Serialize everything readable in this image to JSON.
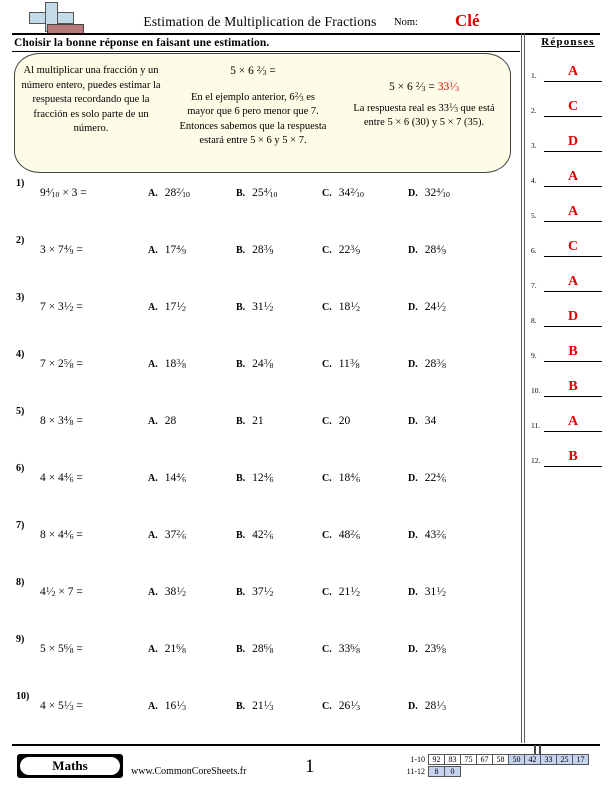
{
  "header": {
    "title": "Estimation de Multiplication de Fractions",
    "name_label": "Nom:",
    "name_value": "Clé",
    "logo_icon": "cross-book-logo"
  },
  "instruction": "Choisir la bonne réponse en faisant une estimation.",
  "example_box": {
    "col1": "Al multiplicar una fracción y un número entero, puedes estimar la respuesta recordando que la fracción es solo parte de un número.",
    "col2_equation": {
      "whole": "5 × 6",
      "num": "2",
      "den": "3",
      "tail": "="
    },
    "col2_text": "En el ejemplo anterior, 6 ⅔ es mayor que 6 pero menor que 7. Entonces sabemos que la respuesta estará entre 5 × 6 y 5 × 7.",
    "col2_text_a": "En el ejemplo anterior, 6",
    "col2_text_b": "es",
    "col2_text_c": "mayor que 6 pero menor que 7.",
    "col2_text_d": "Entonces sabemos que la respuesta",
    "col2_text_e": "estará entre 5 × 6 y 5 × 7.",
    "col3_equation": {
      "whole": "5 × 6",
      "num": "2",
      "den": "3",
      "eq": "=",
      "ans_whole": "33",
      "ans_num": "1",
      "ans_den": "3"
    },
    "col3_text_a": "La respuesta real es 33",
    "col3_text_b": "que está",
    "col3_text_c": "entre 5 × 6 (30) y 5 × 7 (35).",
    "accent_color": "#e00000",
    "background_color": "#fdfce6"
  },
  "questions": [
    {
      "num": "1)",
      "expr": {
        "w": "9",
        "n": "4",
        "d": "10",
        "tail": "× 3 ="
      },
      "options": [
        {
          "label": "A.",
          "w": "28",
          "n": "2",
          "d": "10"
        },
        {
          "label": "B.",
          "w": "25",
          "n": "4",
          "d": "10"
        },
        {
          "label": "C.",
          "w": "34",
          "n": "2",
          "d": "10"
        },
        {
          "label": "D.",
          "w": "32",
          "n": "4",
          "d": "10"
        }
      ]
    },
    {
      "num": "2)",
      "expr": {
        "pre": "3 × 7",
        "w": "",
        "n": "4",
        "d": "9",
        "tail": "="
      },
      "options": [
        {
          "label": "A.",
          "w": "17",
          "n": "4",
          "d": "9"
        },
        {
          "label": "B.",
          "w": "28",
          "n": "3",
          "d": "9"
        },
        {
          "label": "C.",
          "w": "22",
          "n": "3",
          "d": "9"
        },
        {
          "label": "D.",
          "w": "28",
          "n": "4",
          "d": "9"
        }
      ]
    },
    {
      "num": "3)",
      "expr": {
        "pre": "7 × 3",
        "w": "",
        "n": "1",
        "d": "2",
        "tail": "="
      },
      "options": [
        {
          "label": "A.",
          "w": "17",
          "n": "1",
          "d": "2"
        },
        {
          "label": "B.",
          "w": "31",
          "n": "1",
          "d": "2"
        },
        {
          "label": "C.",
          "w": "18",
          "n": "1",
          "d": "2"
        },
        {
          "label": "D.",
          "w": "24",
          "n": "1",
          "d": "2"
        }
      ]
    },
    {
      "num": "4)",
      "expr": {
        "pre": "7 × 2",
        "w": "",
        "n": "5",
        "d": "8",
        "tail": "="
      },
      "options": [
        {
          "label": "A.",
          "w": "18",
          "n": "3",
          "d": "8"
        },
        {
          "label": "B.",
          "w": "24",
          "n": "3",
          "d": "8"
        },
        {
          "label": "C.",
          "w": "11",
          "n": "3",
          "d": "8"
        },
        {
          "label": "D.",
          "w": "28",
          "n": "3",
          "d": "8"
        }
      ]
    },
    {
      "num": "5)",
      "expr": {
        "pre": "8 × 3",
        "w": "",
        "n": "4",
        "d": "8",
        "tail": "="
      },
      "options": [
        {
          "label": "A.",
          "w": "28",
          "n": "",
          "d": ""
        },
        {
          "label": "B.",
          "w": "21",
          "n": "",
          "d": ""
        },
        {
          "label": "C.",
          "w": "20",
          "n": "",
          "d": ""
        },
        {
          "label": "D.",
          "w": "34",
          "n": "",
          "d": ""
        }
      ]
    },
    {
      "num": "6)",
      "expr": {
        "pre": "4 × 4",
        "w": "",
        "n": "4",
        "d": "6",
        "tail": "="
      },
      "options": [
        {
          "label": "A.",
          "w": "14",
          "n": "4",
          "d": "6"
        },
        {
          "label": "B.",
          "w": "12",
          "n": "4",
          "d": "6"
        },
        {
          "label": "C.",
          "w": "18",
          "n": "4",
          "d": "6"
        },
        {
          "label": "D.",
          "w": "22",
          "n": "4",
          "d": "6"
        }
      ]
    },
    {
      "num": "7)",
      "expr": {
        "pre": "8 × 4",
        "w": "",
        "n": "4",
        "d": "6",
        "tail": "="
      },
      "options": [
        {
          "label": "A.",
          "w": "37",
          "n": "2",
          "d": "6"
        },
        {
          "label": "B.",
          "w": "42",
          "n": "2",
          "d": "6"
        },
        {
          "label": "C.",
          "w": "48",
          "n": "2",
          "d": "6"
        },
        {
          "label": "D.",
          "w": "43",
          "n": "2",
          "d": "6"
        }
      ]
    },
    {
      "num": "8)",
      "expr": {
        "w": "4",
        "n": "1",
        "d": "2",
        "tail": "× 7 ="
      },
      "options": [
        {
          "label": "A.",
          "w": "38",
          "n": "1",
          "d": "2"
        },
        {
          "label": "B.",
          "w": "37",
          "n": "1",
          "d": "2"
        },
        {
          "label": "C.",
          "w": "21",
          "n": "1",
          "d": "2"
        },
        {
          "label": "D.",
          "w": "31",
          "n": "1",
          "d": "2"
        }
      ]
    },
    {
      "num": "9)",
      "expr": {
        "pre": "5 × 5",
        "w": "",
        "n": "6",
        "d": "8",
        "tail": "="
      },
      "options": [
        {
          "label": "A.",
          "w": "21",
          "n": "6",
          "d": "8"
        },
        {
          "label": "B.",
          "w": "28",
          "n": "6",
          "d": "8"
        },
        {
          "label": "C.",
          "w": "33",
          "n": "6",
          "d": "8"
        },
        {
          "label": "D.",
          "w": "23",
          "n": "6",
          "d": "8"
        }
      ]
    },
    {
      "num": "10)",
      "expr": {
        "pre": "4 × 5",
        "w": "",
        "n": "1",
        "d": "3",
        "tail": "="
      },
      "options": [
        {
          "label": "A.",
          "w": "16",
          "n": "1",
          "d": "3"
        },
        {
          "label": "B.",
          "w": "21",
          "n": "1",
          "d": "3"
        },
        {
          "label": "C.",
          "w": "26",
          "n": "1",
          "d": "3"
        },
        {
          "label": "D.",
          "w": "28",
          "n": "1",
          "d": "3"
        }
      ]
    }
  ],
  "answers": {
    "title": "Réponses",
    "items": [
      {
        "index": "1.",
        "value": "A"
      },
      {
        "index": "2.",
        "value": "C"
      },
      {
        "index": "3.",
        "value": "D"
      },
      {
        "index": "4.",
        "value": "A"
      },
      {
        "index": "5.",
        "value": "A"
      },
      {
        "index": "6.",
        "value": "C"
      },
      {
        "index": "7.",
        "value": "A"
      },
      {
        "index": "8.",
        "value": "D"
      },
      {
        "index": "9.",
        "value": "B"
      },
      {
        "index": "10.",
        "value": "B"
      },
      {
        "index": "11.",
        "value": "A"
      },
      {
        "index": "12.",
        "value": "B"
      }
    ],
    "accent_color": "#e00000"
  },
  "footer": {
    "badge": "Maths",
    "site": "www.CommonCoreSheets.fr",
    "page": "1",
    "score_table": {
      "row1_label": "1-10",
      "row1": [
        {
          "v": "92",
          "hl": false
        },
        {
          "v": "83",
          "hl": false
        },
        {
          "v": "75",
          "hl": false
        },
        {
          "v": "67",
          "hl": false
        },
        {
          "v": "58",
          "hl": false
        },
        {
          "v": "50",
          "hl": true
        },
        {
          "v": "42",
          "hl": true
        },
        {
          "v": "33",
          "hl": true
        },
        {
          "v": "25",
          "hl": true
        },
        {
          "v": "17",
          "hl": true
        }
      ],
      "row2_label": "11-12",
      "row2": [
        {
          "v": "8",
          "hl": true
        },
        {
          "v": "0",
          "hl": true
        }
      ],
      "highlight_color": "#c5d3ef"
    }
  }
}
